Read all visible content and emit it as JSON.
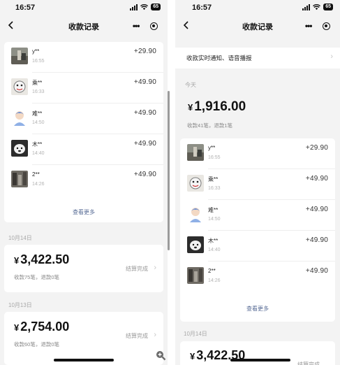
{
  "status_bar": {
    "time": "16:57",
    "battery": "65"
  },
  "nav": {
    "title": "收款记录"
  },
  "notice": {
    "label": "收款实时通知、语音播报"
  },
  "today": {
    "header": "今天",
    "total": "1,916.00",
    "counts": "收款41笔，退款1笔"
  },
  "currency_symbol": "¥",
  "transactions": [
    {
      "name": "y**",
      "time": "16:55",
      "amount": "+29.90"
    },
    {
      "name": "乘**",
      "time": "16:33",
      "amount": "+49.90"
    },
    {
      "name": "难**",
      "time": "14:50",
      "amount": "+49.90"
    },
    {
      "name": "木**",
      "time": "14:40",
      "amount": "+49.90"
    },
    {
      "name": "2**",
      "time": "14:26",
      "amount": "+49.90"
    }
  ],
  "view_more": "查看更多",
  "days": [
    {
      "date": "10月14日",
      "total": "3,422.50",
      "counts": "收款75笔，退款0笔",
      "status": "结算完成"
    },
    {
      "date": "10月13日",
      "total": "2,754.00",
      "counts": "收款60笔，退款0笔",
      "status": "结算完成"
    }
  ],
  "colors": {
    "background": "#f3f3f3",
    "link": "#576b95",
    "muted": "#a8a8a8"
  }
}
